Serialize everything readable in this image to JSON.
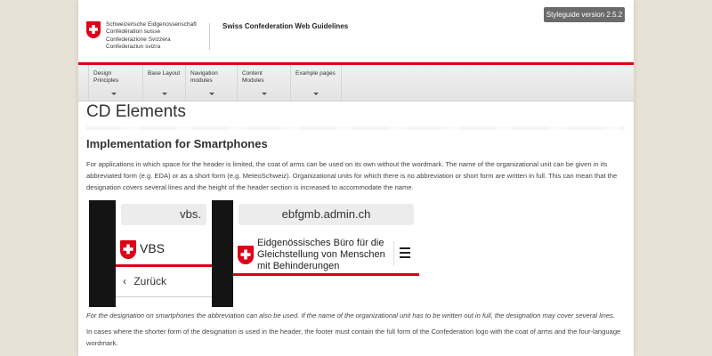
{
  "header": {
    "wordmark": [
      "Schweizerische Eidgenossenschaft",
      "Confédération suisse",
      "Confederazione Svizzera",
      "Confederaziun svizra"
    ],
    "site_title": "Swiss Confederation Web Guidelines",
    "version_button": "Styleguide version 2.5.2",
    "accent_color": "#dc0018"
  },
  "nav": {
    "items": [
      {
        "line1": "Design",
        "line2": "Principles"
      },
      {
        "line1": "Base Layout",
        "line2": ""
      },
      {
        "line1": "Navigation",
        "line2": "modules"
      },
      {
        "line1": "Content",
        "line2": "Modules"
      },
      {
        "line1": "Example pages",
        "line2": ""
      }
    ]
  },
  "content": {
    "page_title": "CD Elements",
    "section_title": "Implementation for Smartphones",
    "paragraph1": "For applications in which space for the header is limited, the coat of arms can be used on its own without the wordmark. The name of the organizational unit can be given in its abbreviated form (e.g. EDA) or as a short form (e.g. MeteoSchweiz). Organizational units for which there is no abbreviation or short form are written in full. This can mean that the designation covers several lines and the height of the header section is increased to accommodate the name.",
    "caption": "For the designation on smartphones the abbreviation can also be used. If the name of the organizational unit has to be written out in full, the designation may cover several lines.",
    "paragraph2": "In cases where the shorter form of the designation is used in the header, the footer must contain the full form of the Confederation logo with the coat of arms and the four-language wordmark."
  },
  "mockups": {
    "phone1": {
      "url": "vbs.",
      "name": "VBS",
      "back_label": "Zurück"
    },
    "phone2": {
      "url": "ebfgmb.admin.ch",
      "name_lines": [
        "Eidgenössisches Büro für die",
        "Gleichstellung von Menschen",
        "mit Behinderungen"
      ],
      "menu_icon": "hamburger-icon"
    }
  }
}
